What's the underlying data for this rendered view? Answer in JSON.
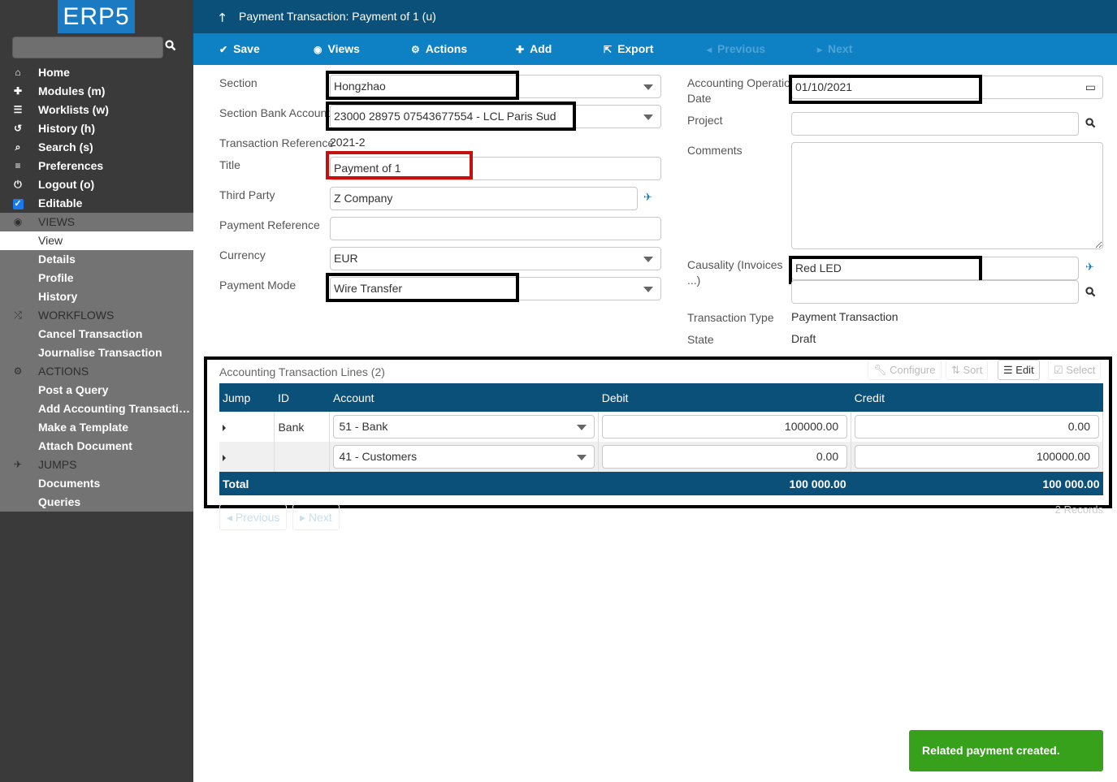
{
  "app": {
    "logo": "ERP5"
  },
  "sidebar": {
    "search_placeholder": "",
    "items": [
      {
        "label": "Home",
        "icon": "home-icon"
      },
      {
        "label": "Modules (m)",
        "icon": "puzzle-icon"
      },
      {
        "label": "Worklists (w)",
        "icon": "tasks-icon"
      },
      {
        "label": "History (h)",
        "icon": "history-icon"
      },
      {
        "label": "Search (s)",
        "icon": "search-icon"
      },
      {
        "label": "Preferences",
        "icon": "sliders-icon"
      },
      {
        "label": "Logout (o)",
        "icon": "power-icon"
      },
      {
        "label": "Editable",
        "icon": "checkbox-icon",
        "checked": true
      }
    ],
    "sections": [
      {
        "header": "VIEWS",
        "icon": "eye-icon",
        "items": [
          "View",
          "Details",
          "Profile",
          "History"
        ],
        "active": "View"
      },
      {
        "header": "WORKFLOWS",
        "icon": "random-icon",
        "items": [
          "Cancel Transaction",
          "Journalise Transaction"
        ]
      },
      {
        "header": "ACTIONS",
        "icon": "cogs-icon",
        "items": [
          "Post a Query",
          "Add Accounting Transaction L...",
          "Make a Template",
          "Attach Document"
        ]
      },
      {
        "header": "JUMPS",
        "icon": "plane-icon",
        "items": [
          "Documents",
          "Queries"
        ]
      }
    ]
  },
  "header": {
    "title": "Payment Transaction: Payment of 1 (u)"
  },
  "toolbar": {
    "save": "Save",
    "views": "Views",
    "actions": "Actions",
    "add": "Add",
    "export": "Export",
    "previous": "Previous",
    "next": "Next"
  },
  "form": {
    "section": {
      "label": "Section",
      "value": "Hongzhao"
    },
    "section_bank_account": {
      "label": "Section Bank Account",
      "value": "23000 28975 07543677554 - LCL Paris Sud"
    },
    "transaction_reference": {
      "label": "Transaction Reference",
      "value": "2021-2"
    },
    "title": {
      "label": "Title",
      "value": "Payment of 1"
    },
    "third_party": {
      "label": "Third Party",
      "value": "Z Company"
    },
    "payment_reference": {
      "label": "Payment Reference",
      "value": ""
    },
    "currency": {
      "label": "Currency",
      "value": "EUR"
    },
    "payment_mode": {
      "label": "Payment Mode",
      "value": "Wire Transfer"
    },
    "accounting_operation_date": {
      "label": "Accounting Operation Date",
      "value": "01/10/2021"
    },
    "project": {
      "label": "Project",
      "value": ""
    },
    "comments": {
      "label": "Comments",
      "value": ""
    },
    "causality": {
      "label": "Causality (Invoices ...)",
      "value": "Red LED",
      "value2": ""
    },
    "transaction_type": {
      "label": "Transaction Type",
      "value": "Payment Transaction"
    },
    "state": {
      "label": "State",
      "value": "Draft"
    }
  },
  "listbox": {
    "title": "Accounting Transaction Lines (2)",
    "tools": {
      "configure": "Configure",
      "sort": "Sort",
      "edit": "Edit",
      "select": "Select"
    },
    "columns": [
      "Jump",
      "ID",
      "Account",
      "Debit",
      "Credit"
    ],
    "rows": [
      {
        "id": "Bank",
        "account": "51 - Bank",
        "debit": "100000.00",
        "credit": "0.00"
      },
      {
        "id": "",
        "account": "41 - Customers",
        "debit": "0.00",
        "credit": "100000.00"
      }
    ],
    "total": {
      "label": "Total",
      "debit": "100 000.00",
      "credit": "100 000.00"
    },
    "pager": {
      "previous": "Previous",
      "next": "Next"
    },
    "records": "2 Records"
  },
  "notification": {
    "message": "Related payment created.",
    "color": "#37a11b"
  },
  "colors": {
    "header": "#0a5079",
    "toolbar": "#0e80c4",
    "sidebar": "#3a3a3a"
  }
}
